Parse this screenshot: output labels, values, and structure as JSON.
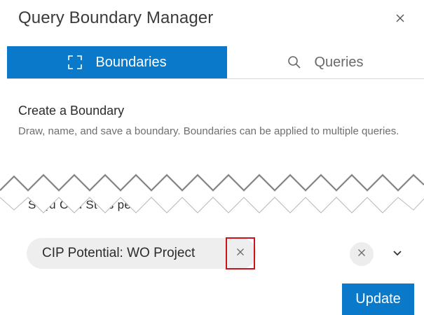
{
  "dialog": {
    "title": "Query Boundary Manager",
    "close_icon": "close-icon"
  },
  "tabs": [
    {
      "label": "Boundaries",
      "icon": "boundary-icon",
      "active": true
    },
    {
      "label": "Queries",
      "icon": "search-icon",
      "active": false
    }
  ],
  "create_boundary": {
    "title": "Create a Boundary",
    "description": "Draw, name, and save a boundary. Boundaries can be applied to multiple queries."
  },
  "partial_chip": {
    "text": "S  Qu   C  tu   St  us  pe  P"
  },
  "selected_query": {
    "label": "CIP Potential: WO Project",
    "remove_icon": "close-icon"
  },
  "controls": {
    "clear_icon": "close-icon",
    "dropdown_icon": "chevron-down-icon"
  },
  "footer": {
    "update_label": "Update"
  },
  "colors": {
    "accent": "#0a79c9",
    "highlight": "#c8141c",
    "chip_bg": "#eeeeee"
  }
}
